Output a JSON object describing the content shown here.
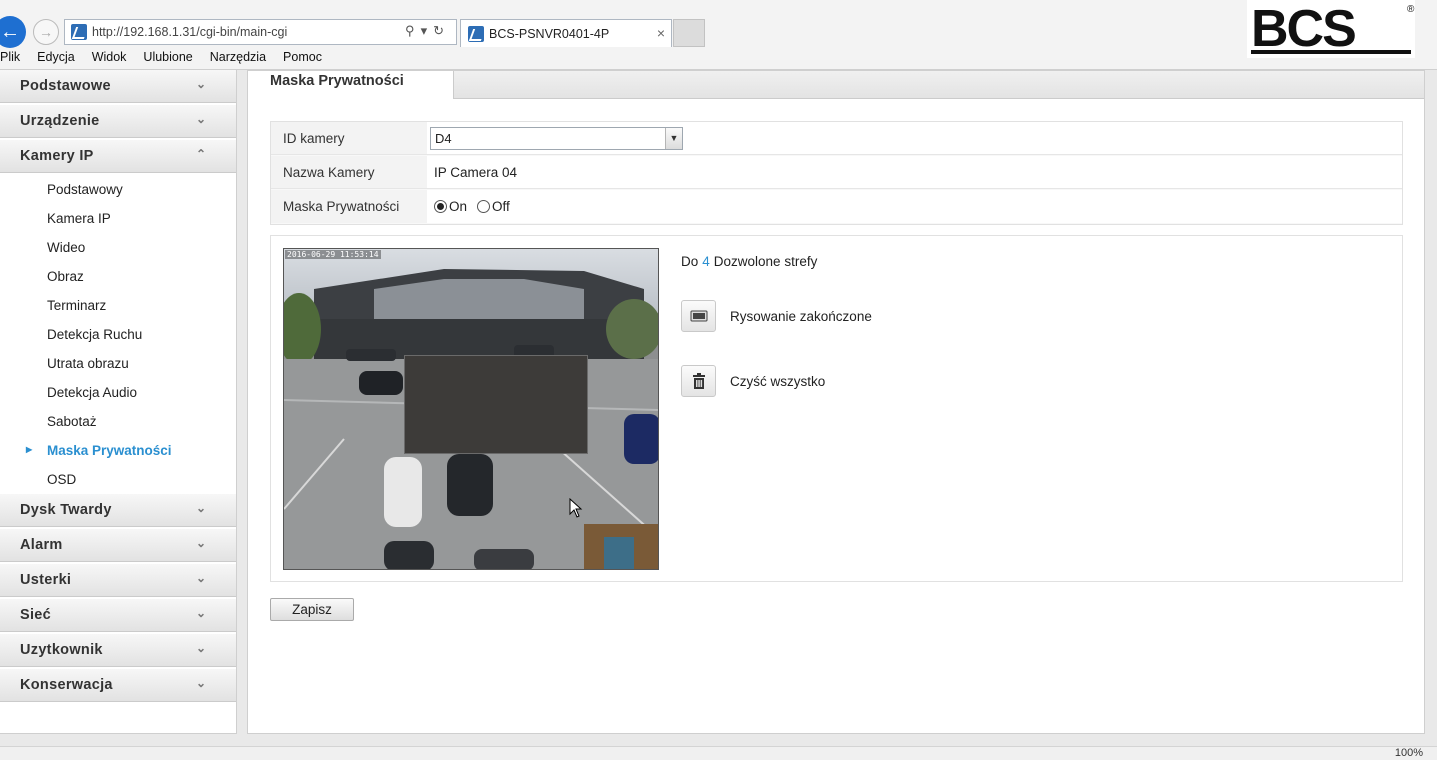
{
  "browser": {
    "address": "http://192.168.1.31/cgi-bin/main-cgi",
    "tab_title": "BCS-PSNVR0401-4P",
    "menu": [
      "Plik",
      "Edycja",
      "Widok",
      "Ulubione",
      "Narzędzia",
      "Pomoc"
    ],
    "logo_text": "BCS",
    "zoom": "100%"
  },
  "sidebar": {
    "categories_top": [
      {
        "label": "Podstawowe"
      },
      {
        "label": "Urządzenie"
      },
      {
        "label": "Kamery IP"
      }
    ],
    "subitems": [
      {
        "label": "Podstawowy"
      },
      {
        "label": "Kamera IP"
      },
      {
        "label": "Wideo"
      },
      {
        "label": "Obraz"
      },
      {
        "label": "Terminarz"
      },
      {
        "label": "Detekcja Ruchu"
      },
      {
        "label": "Utrata obrazu"
      },
      {
        "label": "Detekcja Audio"
      },
      {
        "label": "Sabotaż"
      },
      {
        "label": "Maska Prywatności"
      },
      {
        "label": "OSD"
      }
    ],
    "categories_bottom": [
      {
        "label": "Dysk Twardy"
      },
      {
        "label": "Alarm"
      },
      {
        "label": "Usterki"
      },
      {
        "label": "Sieć"
      },
      {
        "label": "Uzytkownik"
      },
      {
        "label": "Konserwacja"
      }
    ]
  },
  "main": {
    "tab_label": "Maska Prywatności",
    "form": {
      "camera_id_label": "ID kamery",
      "camera_id_value": "D4",
      "camera_name_label": "Nazwa Kamery",
      "camera_name_value": "IP Camera 04",
      "mask_label": "Maska Prywatności",
      "mask_on": "On",
      "mask_off": "Off",
      "mask_selected": "On"
    },
    "preview": {
      "timestamp": "2016-06-29 11:53:14"
    },
    "zones": {
      "prefix": "Do",
      "count": "4",
      "suffix": "Dozwolone strefy"
    },
    "draw_done_label": "Rysowanie zakończone",
    "clear_all_label": "Czyść wszystko",
    "save_label": "Zapisz"
  }
}
